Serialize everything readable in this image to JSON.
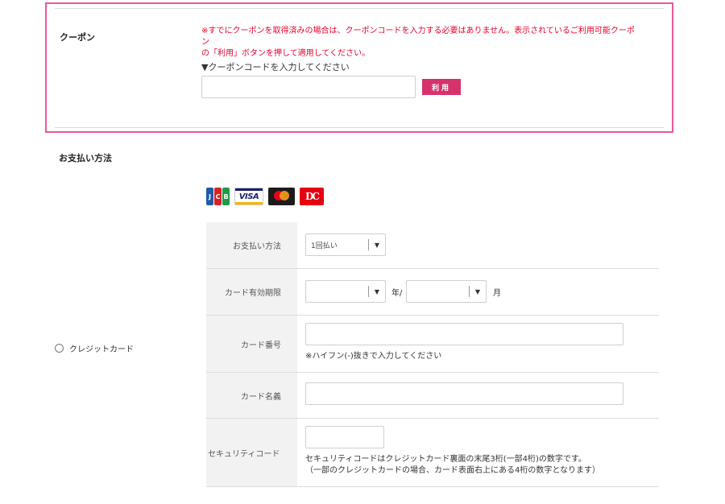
{
  "coupon": {
    "heading": "クーポン",
    "notice_line1": "※すでにクーポンを取得済みの場合は、クーポンコードを入力する必要はありません。表示されているご利用可能クーポン",
    "notice_line2": "の「利用」ボタンを押して適用してください。",
    "prompt": "▼クーポンコードを入力してください",
    "input_value": "",
    "apply_label": "利用"
  },
  "payment": {
    "heading": "お支払い方法",
    "card_logos": {
      "jcb_letters": [
        "J",
        "C",
        "B"
      ],
      "visa": "VISA",
      "diners": "DC"
    },
    "option_label": "クレジットカード",
    "rows": {
      "method": {
        "label": "お支払い方法",
        "value": "1回払い"
      },
      "expiry": {
        "label": "カード有効期限",
        "month_value": "",
        "year_unit": "年/",
        "year_value": "",
        "month_unit": "月"
      },
      "number": {
        "label": "カード番号",
        "value": "",
        "hint": "※ハイフン(-)抜きで入力してください"
      },
      "name": {
        "label": "カード名義",
        "value": ""
      },
      "security": {
        "label": "セキュリティコード",
        "value": "",
        "hint_line1": "セキュリティコードはクレジットカード裏面の末尾3桁(一部4桁)の数字です。",
        "hint_line2": "（一部のクレジットカードの場合、カード表面右上にある4桁の数字となります）"
      }
    },
    "dropdown_arrow": "▼"
  },
  "colors": {
    "coupon_border": "#e9579b",
    "apply_button": "#d6336c",
    "notice_text": "#e6002d",
    "jcb_blue": "#1f5aa6",
    "jcb_red": "#d62129",
    "jcb_green": "#1e9a44"
  }
}
